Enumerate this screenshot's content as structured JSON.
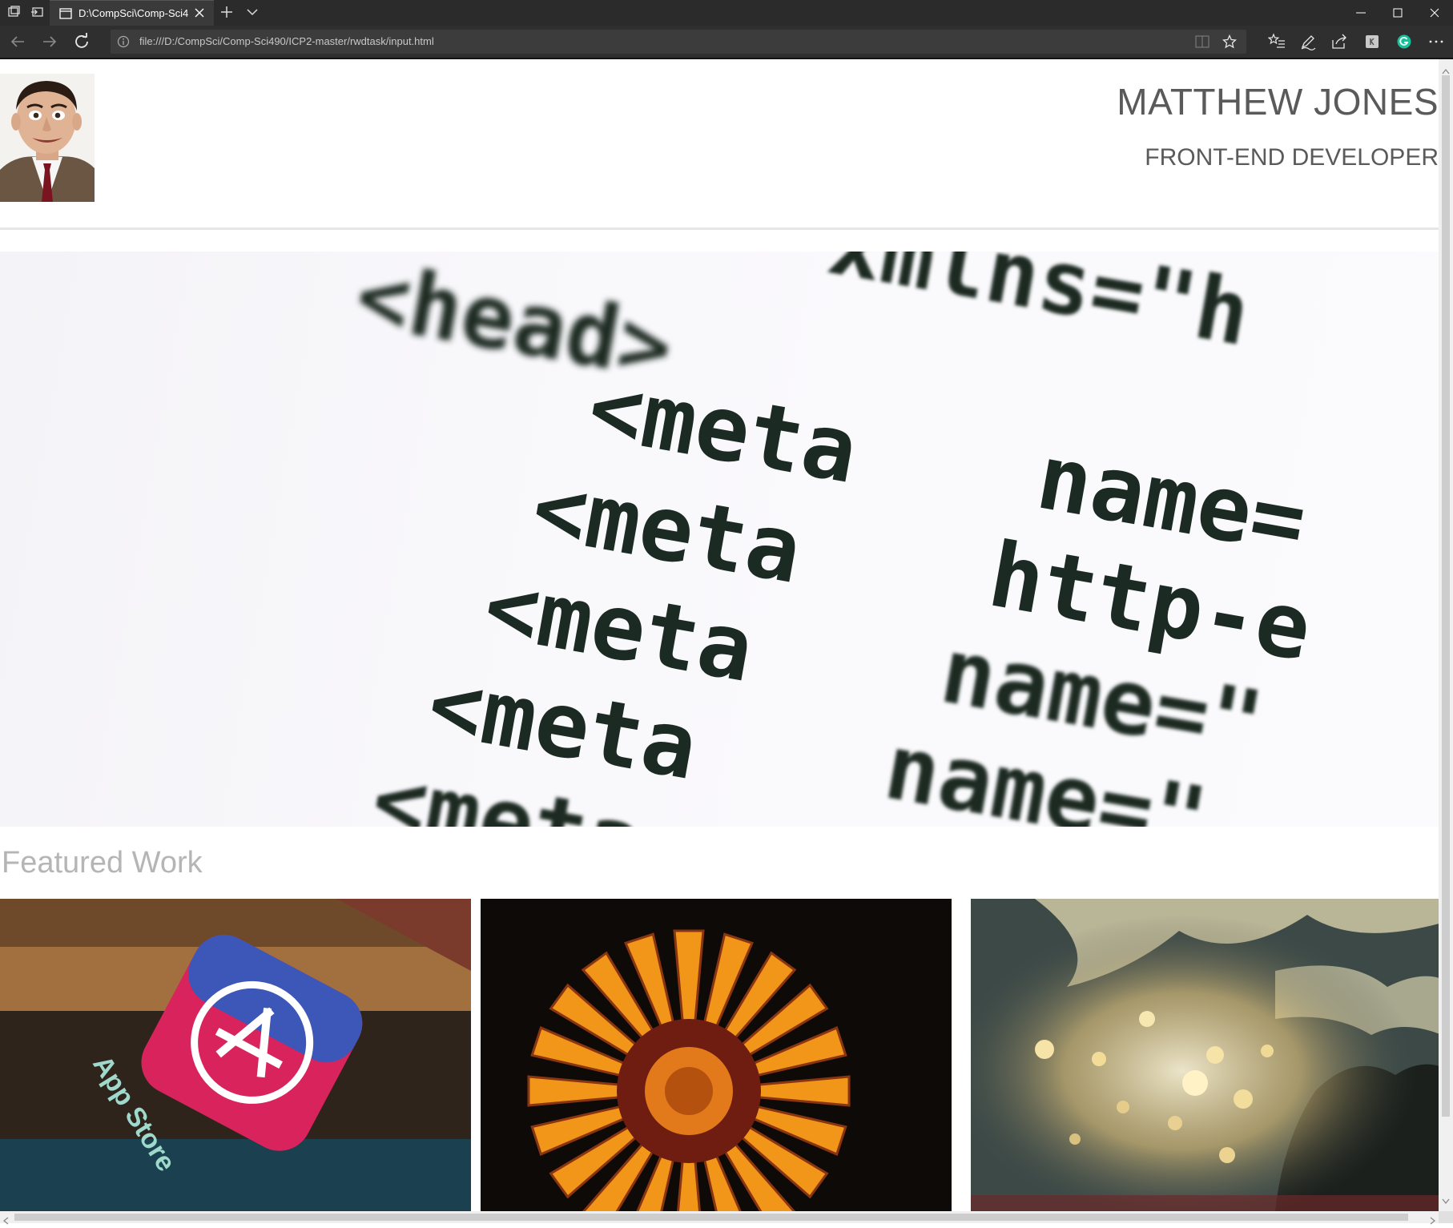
{
  "browser": {
    "tab_title": "D:\\CompSci\\Comp-Sci4",
    "url": "file:///D:/CompSci/Comp-Sci490/ICP2-master/rwdtask/input.html"
  },
  "header": {
    "name": "MATTHEW JONES",
    "role": "FRONT-END DEVELOPER"
  },
  "hero": {
    "code_lines": [
      "<head>",
      "xmlns=\"h",
      "<meta",
      "name=",
      "<meta",
      "http-e",
      "<meta",
      "name=\"",
      "<meta",
      "name=\"",
      "<meta"
    ]
  },
  "featured": {
    "heading": "Featured Work",
    "items": [
      {
        "icon": "app-store-image",
        "caption": "App Store"
      },
      {
        "icon": "flower-image"
      },
      {
        "icon": "bokeh-lights-image"
      }
    ]
  },
  "colors": {
    "chrome_dark": "#2b2b2b",
    "heading_text": "#5a5a5a",
    "featured_text": "#b5b5b5"
  }
}
